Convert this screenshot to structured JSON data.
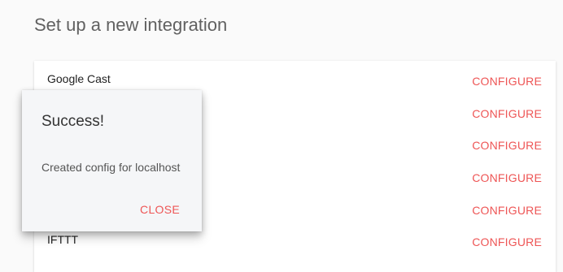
{
  "page": {
    "title": "Set up a new integration"
  },
  "integrations": [
    {
      "name": "Google Cast",
      "action": "CONFIGURE"
    },
    {
      "name": "",
      "action": "CONFIGURE"
    },
    {
      "name": "",
      "action": "CONFIGURE"
    },
    {
      "name": "",
      "action": "CONFIGURE"
    },
    {
      "name": "",
      "action": "CONFIGURE"
    },
    {
      "name": "IFTTT",
      "action": "CONFIGURE"
    }
  ],
  "dialog": {
    "title": "Success!",
    "message": "Created config for localhost",
    "close_label": "CLOSE"
  },
  "colors": {
    "accent": "#ee5555",
    "background": "#fafafa",
    "card": "#ffffff",
    "dialog": "#f5f6f8"
  }
}
